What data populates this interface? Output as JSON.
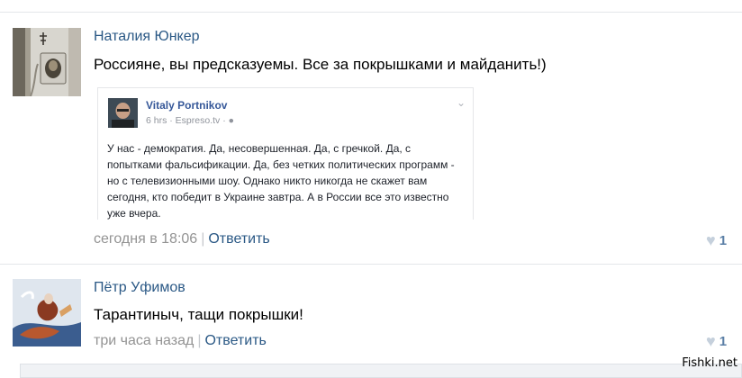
{
  "comments": [
    {
      "author": "Наталия Юнкер",
      "text": "Россияне, вы предсказуемы. Все за покрышками и майданить!)",
      "time": "сегодня в 18:06",
      "reply_label": "Ответить",
      "likes": "1",
      "embed": {
        "name": "Vitaly Portnikov",
        "sub": "6 hrs · Espreso.tv · ",
        "globe_icon": "globe-icon",
        "body": "У нас - демократия. Да, несовершенная. Да, с гречкой. Да, с попытками фальсификации. Да, без четких политических программ - но с телевизионными шоу. Однако никто никогда не скажет вам сегодня, кто победит в Украине завтра. А в России все это известно уже вчера."
      }
    },
    {
      "author": "Пётр Уфимов",
      "text": "Тарантиныч, тащи покрышки!",
      "time": "три часа назад",
      "reply_label": "Ответить",
      "likes": "1"
    }
  ],
  "watermark": "Fishki.net",
  "colors": {
    "link": "#2a5885",
    "meta": "#939393",
    "heart": "#c5d0dc"
  }
}
